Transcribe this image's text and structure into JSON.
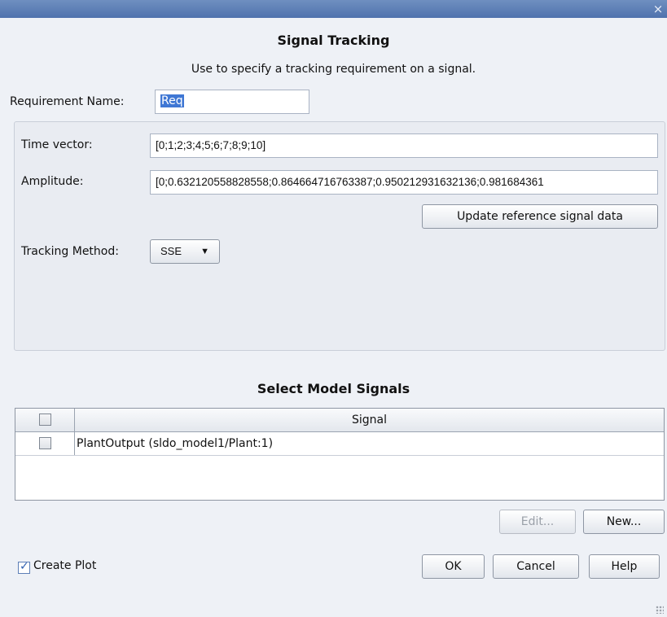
{
  "window": {
    "close_glyph": "×"
  },
  "header": {
    "title": "Signal Tracking",
    "subtitle": "Use to specify a tracking requirement on a signal."
  },
  "requirement": {
    "label": "Requirement Name:",
    "value": "Req"
  },
  "signal_data": {
    "time_label": "Time vector:",
    "time_value": "[0;1;2;3;4;5;6;7;8;9;10]",
    "amplitude_label": "Amplitude:",
    "amplitude_value": "[0;0.632120558828558;0.864664716763387;0.950212931632136;0.981684361",
    "update_button": "Update reference signal data",
    "tracking_label": "Tracking Method:",
    "tracking_value": "SSE"
  },
  "model_signals": {
    "title": "Select Model Signals",
    "column_header": "Signal",
    "rows": [
      {
        "checked": false,
        "signal": "PlantOutput (sldo_model1/Plant:1)"
      }
    ],
    "edit_button": "Edit...",
    "new_button": "New..."
  },
  "footer": {
    "create_plot_label": "Create Plot",
    "create_plot_checked": true,
    "ok_button": "OK",
    "cancel_button": "Cancel",
    "help_button": "Help"
  },
  "colors": {
    "titlebar": "#5a7db6",
    "selection": "#3f77d4",
    "background": "#eef1f6"
  }
}
